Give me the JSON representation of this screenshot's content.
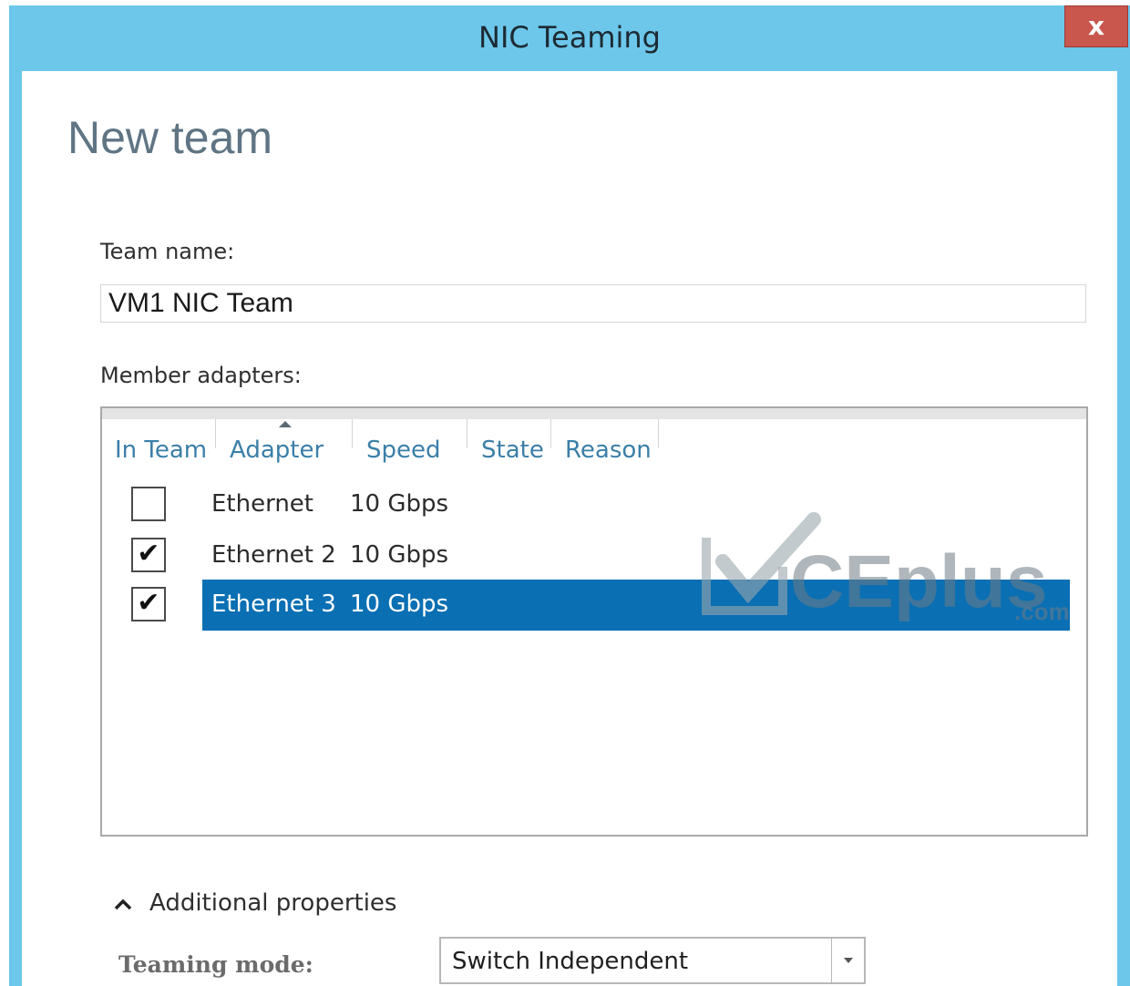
{
  "window": {
    "title": "NIC Teaming",
    "close_label": "x",
    "background": "#6cc7ea"
  },
  "page": {
    "heading": "New team"
  },
  "team_name": {
    "label": "Team name:",
    "value": "VM1 NIC Team"
  },
  "member_adapters": {
    "label": "Member adapters:",
    "columns": [
      "In Team",
      "Adapter",
      "Speed",
      "State",
      "Reason"
    ],
    "sorted_column": "Adapter",
    "rows": [
      {
        "in_team": false,
        "adapter": "Ethernet",
        "speed": "10 Gbps",
        "state": "",
        "reason": "",
        "selected": false
      },
      {
        "in_team": true,
        "adapter": "Ethernet 2",
        "speed": "10 Gbps",
        "state": "",
        "reason": "",
        "selected": false
      },
      {
        "in_team": true,
        "adapter": "Ethernet 3",
        "speed": "10 Gbps",
        "state": "",
        "reason": "",
        "selected": true
      }
    ],
    "selection_color": "#0a6fb3"
  },
  "watermark": {
    "text": "CEplus",
    "suffix": ".com"
  },
  "additional_properties": {
    "label": "Additional properties",
    "expanded": true
  },
  "teaming_mode": {
    "label": "Teaming mode:",
    "value": "Switch Independent"
  }
}
